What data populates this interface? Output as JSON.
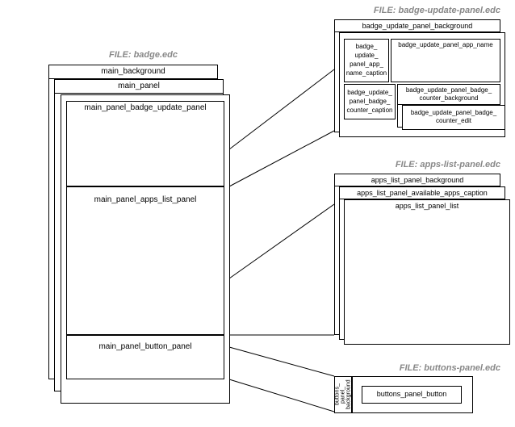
{
  "files": {
    "badge": "FILE: badge.edc",
    "badge_update_panel": "FILE: badge-update-panel.edc",
    "apps_list_panel": "FILE: apps-list-panel.edc",
    "buttons_panel": "FILE: buttons-panel.edc"
  },
  "left": {
    "main_background": "main_background",
    "main_panel": "main_panel",
    "main_panel_badge_update_panel": "main_panel_badge_update_panel",
    "main_panel_apps_list_panel": "main_panel_apps_list_panel",
    "main_panel_button_panel": "main_panel_button_panel"
  },
  "badge_update": {
    "background": "badge_update_panel_background",
    "name_caption": "badge_\nupdate_\npanel_app_\nname_caption",
    "app_name": "badge_update_panel_app_name",
    "counter_caption": "badge_update_\npanel_badge_\ncounter_caption",
    "counter_background": "badge_update_panel_badge_\ncounter_background",
    "counter_edit": "badge_update_panel_badge_\ncounter_edit"
  },
  "apps_list": {
    "background": "apps_list_panel_background",
    "caption": "apps_list_panel_available_apps_caption",
    "list": "apps_list_panel_list"
  },
  "buttons": {
    "background": "buttons_\npanel_\nbackground",
    "button": "buttons_panel_button"
  }
}
